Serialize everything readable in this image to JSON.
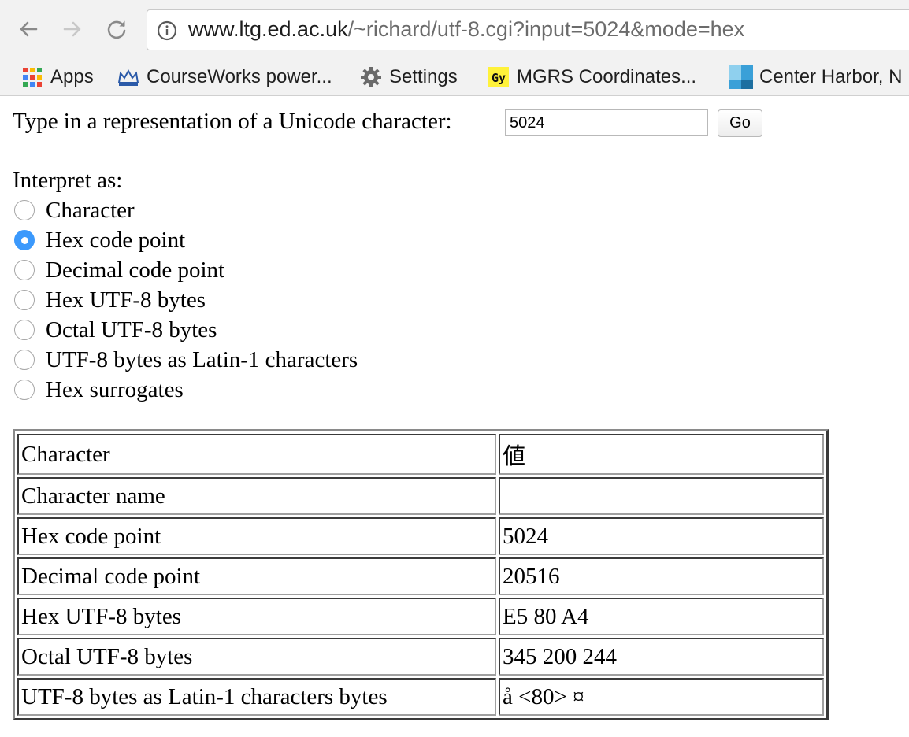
{
  "browser": {
    "url_host": "www.ltg.ed.ac.uk",
    "url_path": "/~richard/utf-8.cgi?input=5024&mode=hex",
    "bookmarks": [
      {
        "label": "Apps",
        "icon": "apps-grid-icon"
      },
      {
        "label": "CourseWorks power...",
        "icon": "crown-icon"
      },
      {
        "label": "Settings",
        "icon": "gear-icon"
      },
      {
        "label": "MGRS Coordinates...",
        "icon": "gy-logo-icon"
      },
      {
        "label": "Center Harbor, N",
        "icon": "map-tile-icon"
      }
    ]
  },
  "form": {
    "prompt": "Type in a representation of a Unicode character:",
    "input_value": "5024",
    "go_label": "Go",
    "interpret_label": "Interpret as:",
    "options": [
      {
        "label": "Character",
        "checked": false
      },
      {
        "label": "Hex code point",
        "checked": true
      },
      {
        "label": "Decimal code point",
        "checked": false
      },
      {
        "label": "Hex UTF-8 bytes",
        "checked": false
      },
      {
        "label": "Octal UTF-8 bytes",
        "checked": false
      },
      {
        "label": "UTF-8 bytes as Latin-1 characters",
        "checked": false
      },
      {
        "label": "Hex surrogates",
        "checked": false
      }
    ]
  },
  "results": [
    {
      "label": "Character",
      "value": "値"
    },
    {
      "label": "Character name",
      "value": ""
    },
    {
      "label": "Hex code point",
      "value": "5024"
    },
    {
      "label": "Decimal code point",
      "value": "20516"
    },
    {
      "label": "Hex UTF-8 bytes",
      "value": "E5 80 A4"
    },
    {
      "label": "Octal UTF-8 bytes",
      "value": "345 200 244"
    },
    {
      "label": "UTF-8 bytes as Latin-1 characters bytes",
      "value": "å <80> ¤"
    }
  ],
  "colors": {
    "radio_checked": "#3b99fc",
    "chrome_bg": "#f2f2f2"
  }
}
